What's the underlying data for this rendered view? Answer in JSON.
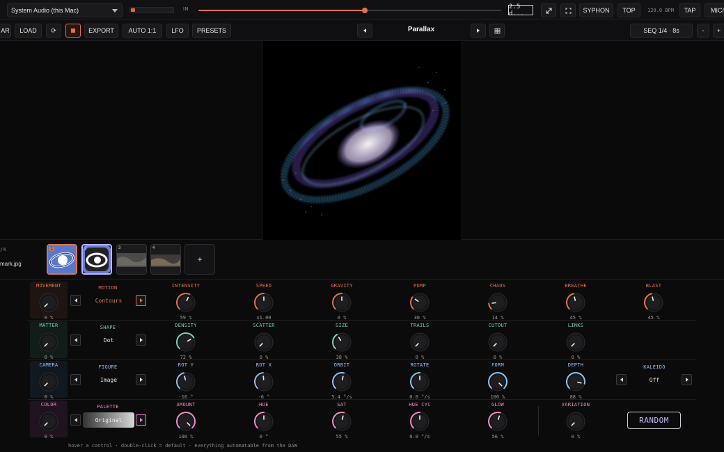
{
  "topbar": {
    "audio_source": "System Audio (this Mac)",
    "in_label": "IN",
    "meter_level": 0.1,
    "position": 0.55,
    "time_value": "2.5 d...",
    "syphon": "SYPHON",
    "top": "TOP",
    "bpm": "120.0 BPM",
    "tap": "TAP",
    "mic": "MIC/"
  },
  "toolbar": {
    "partial_left": "AR",
    "load": "LOAD",
    "refresh_glyph": "⟳",
    "export": "EXPORT",
    "auto": "AUTO 1:1",
    "lfo": "LFO",
    "presets": "PRESETS",
    "preset_name": "Parallax",
    "seq": "SEQ 1/4 · 8s",
    "minus": "-",
    "plus": "+"
  },
  "strip": {
    "index_text": "/4",
    "file_name": "mark.jpg",
    "thumbs": [
      "1",
      "2",
      "3",
      "4"
    ],
    "add": "+"
  },
  "colors": {
    "movement": "#e0734a",
    "matter": "#7fd0b0",
    "camera": "#8cc4f0",
    "color": "#f08ccb"
  },
  "rows": {
    "movement": {
      "cat": "MOVEMENT",
      "cat_val": "0 %",
      "selector_label": "MOTION",
      "selector_value": "Contours",
      "controls": [
        {
          "label": "INTENSITY",
          "value": "59 %",
          "level": 0.59
        },
        {
          "label": "SPEED",
          "value": "x1.00",
          "level": 0.5
        },
        {
          "label": "GRAVITY",
          "value": "0 %",
          "level": 0.5
        },
        {
          "label": "PUMP",
          "value": "30 %",
          "level": 0.3
        },
        {
          "label": "CHAOS",
          "value": "14 %",
          "level": 0.14
        },
        {
          "label": "BREATHE",
          "value": "45 %",
          "level": 0.45
        },
        {
          "label": "BLAST",
          "value": "45 %",
          "level": 0.45
        }
      ]
    },
    "matter": {
      "cat": "MATTER",
      "cat_val": "0 %",
      "selector_label": "SHAPE",
      "selector_value": "Dot",
      "controls": [
        {
          "label": "DENSITY",
          "value": "72 %",
          "level": 0.72
        },
        {
          "label": "SCATTER",
          "value": "0 %",
          "level": 0.0
        },
        {
          "label": "SIZE",
          "value": "38 %",
          "level": 0.38
        },
        {
          "label": "TRAILS",
          "value": "0 %",
          "level": 0.0
        },
        {
          "label": "CUTOUT",
          "value": "0 %",
          "level": 0.0
        },
        {
          "label": "LINKS",
          "value": "0 %",
          "level": 0.0
        }
      ]
    },
    "camera": {
      "cat": "CAMERA",
      "cat_val": "0 %",
      "selector_label": "FIGURE",
      "selector_value": "Image",
      "controls": [
        {
          "label": "ROT Y",
          "value": "-16 °",
          "level": 0.45
        },
        {
          "label": "ROT X",
          "value": "-6 °",
          "level": 0.48
        },
        {
          "label": "ORBIT",
          "value": "5.4 °/s",
          "level": 0.55
        },
        {
          "label": "ROTATE",
          "value": "0.0 °/s",
          "level": 0.5
        },
        {
          "label": "FORM",
          "value": "100 %",
          "level": 1.0
        },
        {
          "label": "DEPTH",
          "value": "88 %",
          "level": 0.88
        }
      ],
      "extra_label": "KALEIDO",
      "extra_value": "Off"
    },
    "color": {
      "cat": "COLOR",
      "cat_val": "0 %",
      "selector_label": "PALETTE",
      "selector_value": "Original",
      "controls": [
        {
          "label": "AMOUNT",
          "value": "100 %",
          "level": 1.0
        },
        {
          "label": "HUE",
          "value": "0 °",
          "level": 0.5
        },
        {
          "label": "SAT",
          "value": "55 %",
          "level": 0.55
        },
        {
          "label": "HUE CYC",
          "value": "0.0 °/s",
          "level": 0.5
        },
        {
          "label": "GLOW",
          "value": "56 %",
          "level": 0.56
        },
        {
          "label": "VARIATION",
          "value": "0 %",
          "level": 0.0
        }
      ],
      "random": "RANDOM"
    }
  },
  "hint": "hover a control · double-click = default · everything automatable from the DAW"
}
